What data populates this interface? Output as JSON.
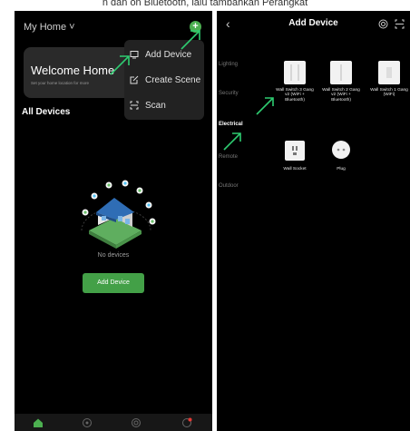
{
  "caption": "n dan on Bluetooth, lalu tambahkan Perangkat",
  "left_screen": {
    "home_selector": "My Home ˅",
    "welcome_title": "Welcome Home",
    "welcome_subtitle": "Set your home location for more",
    "all_devices": "All Devices",
    "menu": {
      "items": [
        {
          "label": "Add Device",
          "icon": "add-device-icon"
        },
        {
          "label": "Create Scene",
          "icon": "create-scene-icon"
        },
        {
          "label": "Scan",
          "icon": "scan-icon"
        }
      ]
    },
    "empty_state": "No devices",
    "add_device_button": "Add Device",
    "tabs": [
      {
        "icon": "home-icon",
        "active": true
      },
      {
        "icon": "scene-icon",
        "active": false
      },
      {
        "icon": "smart-icon",
        "active": false
      },
      {
        "icon": "profile-icon",
        "active": false
      }
    ]
  },
  "right_screen": {
    "title": "Add Device",
    "categories": [
      "Lighting",
      "Security",
      "Electrical",
      "Remote",
      "Outdoor"
    ],
    "selected_category": "Electrical",
    "devices_row1": [
      {
        "label": "Wall Switch 3 Gang v2 (WiFi + Bluetooth)"
      },
      {
        "label": "Wall Switch 2 Gang v2 (WiFi + Bluetooth)"
      },
      {
        "label": "Wall Switch 1 Gang (WiFi)"
      }
    ],
    "devices_row2": [
      {
        "label": "Wall Socket"
      },
      {
        "label": "Plug"
      }
    ]
  },
  "colors": {
    "accent": "#43a047",
    "arrow": "#2ecc71",
    "background": "#000000"
  }
}
